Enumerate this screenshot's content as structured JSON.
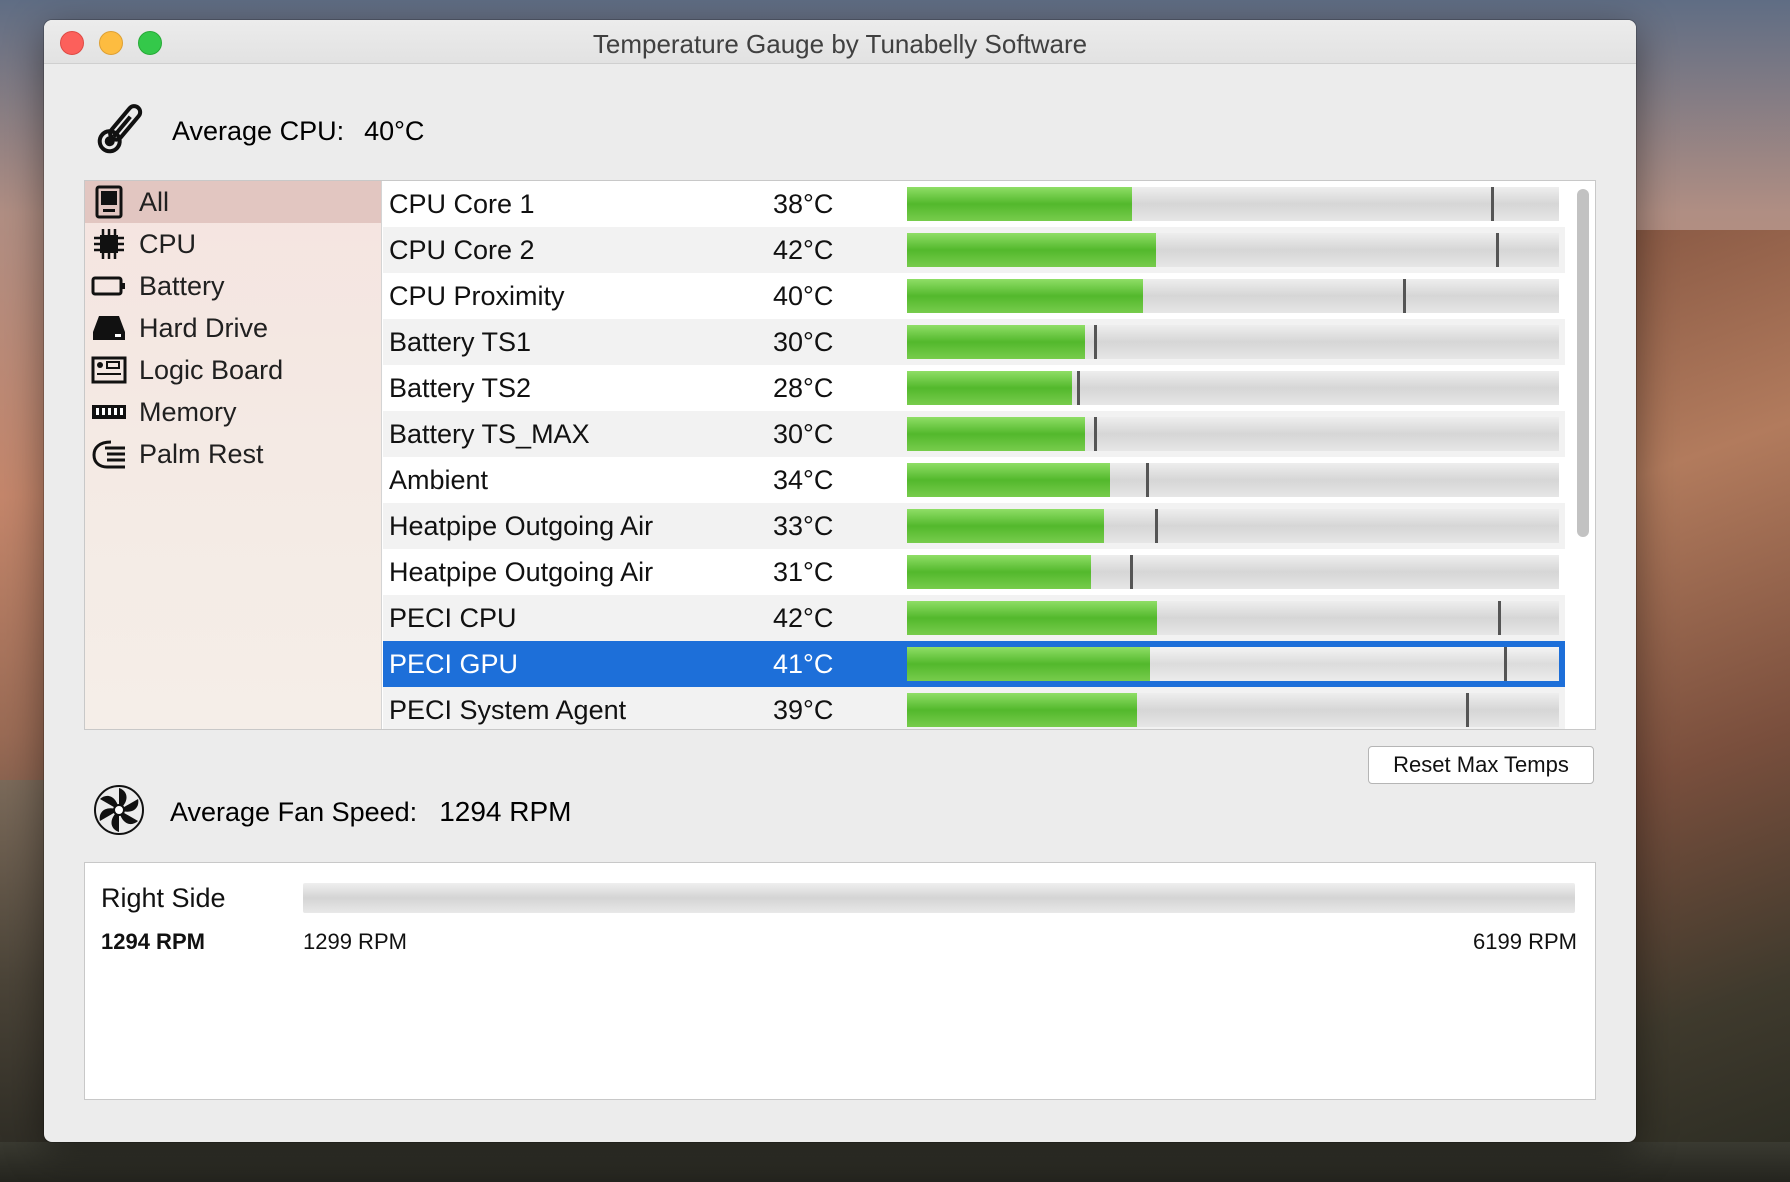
{
  "window": {
    "title": "Temperature Gauge by Tunabelly Software"
  },
  "cpu": {
    "label": "Average CPU:",
    "value": "40°C"
  },
  "sidebar": {
    "items": [
      {
        "label": "All",
        "icon": "computer-icon",
        "selected": true
      },
      {
        "label": "CPU",
        "icon": "chip-icon"
      },
      {
        "label": "Battery",
        "icon": "battery-icon"
      },
      {
        "label": "Hard Drive",
        "icon": "hard-drive-icon"
      },
      {
        "label": "Logic Board",
        "icon": "logic-board-icon"
      },
      {
        "label": "Memory",
        "icon": "memory-icon"
      },
      {
        "label": "Palm Rest",
        "icon": "palm-rest-icon"
      }
    ]
  },
  "sensors": [
    {
      "name": "CPU Core 1",
      "temp": "38°C",
      "level": 0.345,
      "max_level": 0.895
    },
    {
      "name": "CPU Core 2",
      "temp": "42°C",
      "level": 0.382,
      "max_level": 0.903
    },
    {
      "name": "CPU Proximity",
      "temp": "40°C",
      "level": 0.362,
      "max_level": 0.76
    },
    {
      "name": "Battery TS1",
      "temp": "30°C",
      "level": 0.273,
      "max_level": 0.287
    },
    {
      "name": "Battery TS2",
      "temp": "28°C",
      "level": 0.253,
      "max_level": 0.26
    },
    {
      "name": "Battery TS_MAX",
      "temp": "30°C",
      "level": 0.273,
      "max_level": 0.287
    },
    {
      "name": "Ambient",
      "temp": "34°C",
      "level": 0.312,
      "max_level": 0.367
    },
    {
      "name": "Heatpipe Outgoing Air",
      "temp": "33°C",
      "level": 0.302,
      "max_level": 0.38
    },
    {
      "name": "Heatpipe Outgoing Air",
      "temp": "31°C",
      "level": 0.282,
      "max_level": 0.342
    },
    {
      "name": "PECI CPU",
      "temp": "42°C",
      "level": 0.383,
      "max_level": 0.906
    },
    {
      "name": "PECI GPU",
      "temp": "41°C",
      "level": 0.373,
      "max_level": 0.915,
      "selected": true
    },
    {
      "name": "PECI System Agent",
      "temp": "39°C",
      "level": 0.353,
      "max_level": 0.857
    }
  ],
  "reset_button": "Reset Max Temps",
  "fan": {
    "label": "Average Fan Speed:",
    "value": "1294 RPM"
  },
  "fans": [
    {
      "name": "Right Side",
      "rpm": "1294 RPM",
      "min": "1299 RPM",
      "max": "6199 RPM",
      "level": 0
    }
  ],
  "colors": {
    "selection": "#1d6fd9",
    "bar_fill": "#5cc236",
    "sidebar_selected": "#e2c6c1"
  }
}
